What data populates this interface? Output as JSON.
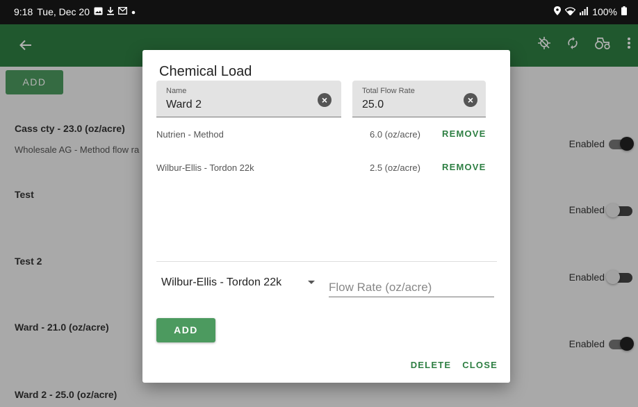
{
  "status_bar": {
    "time": "9:18",
    "date": "Tue, Dec 20",
    "battery": "100%",
    "left_icons": [
      "image-icon",
      "download-icon",
      "mail-icon",
      "dot-icon"
    ],
    "right_icons": [
      "location-icon",
      "wifi-icon",
      "signal-icon",
      "battery-icon"
    ]
  },
  "app_bar": {
    "back_icon": "arrow-back-icon",
    "actions": [
      "gps-off-icon",
      "sync-icon",
      "tractor-icon",
      "more-vert-icon"
    ]
  },
  "background": {
    "add_label": "ADD",
    "items": [
      {
        "title": "Cass cty - 23.0 (oz/acre)",
        "subtitle": "Wholesale AG - Method flow ra",
        "enabled_label": "Enabled",
        "enabled": true
      },
      {
        "title": "Test",
        "subtitle": "",
        "enabled_label": "Enabled",
        "enabled": false
      },
      {
        "title": "Test 2",
        "subtitle": "",
        "enabled_label": "Enabled",
        "enabled": false
      },
      {
        "title": "Ward - 21.0 (oz/acre)",
        "subtitle": "",
        "enabled_label": "Enabled",
        "enabled": true
      },
      {
        "title": "Ward 2 - 25.0 (oz/acre)",
        "subtitle": "",
        "enabled_label": "",
        "enabled": null
      }
    ]
  },
  "dialog": {
    "title": "Chemical Load",
    "name_field": {
      "label": "Name",
      "value": "Ward 2"
    },
    "flow_field": {
      "label": "Total Flow Rate",
      "value": "25.0"
    },
    "chemicals": [
      {
        "name": "Nutrien - Method",
        "rate": "6.0 (oz/acre)",
        "remove_label": "REMOVE"
      },
      {
        "name": "Wilbur-Ellis - Tordon 22k",
        "rate": "2.5 (oz/acre)",
        "remove_label": "REMOVE"
      }
    ],
    "select_value": "Wilbur-Ellis - Tordon 22k",
    "rate_placeholder": "Flow Rate (oz/acre)",
    "add_label": "ADD",
    "delete_label": "DELETE",
    "close_label": "CLOSE"
  },
  "colors": {
    "primary": "#2e7f43",
    "button": "#4c9a5f"
  }
}
